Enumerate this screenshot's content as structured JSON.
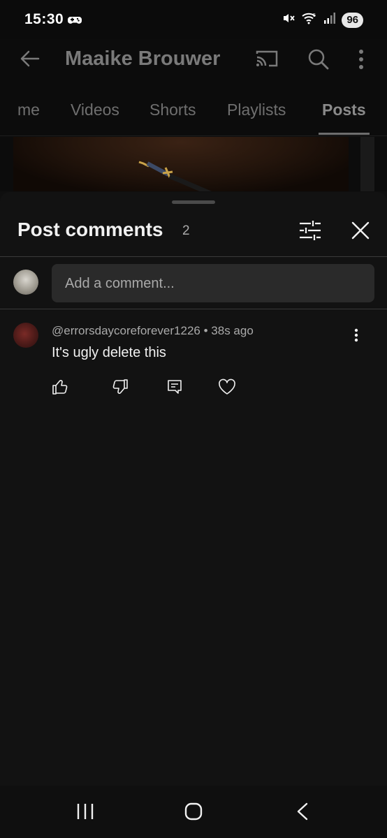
{
  "status_bar": {
    "time": "15:30",
    "battery": "96",
    "icons": [
      "game-controller-icon",
      "mute-icon",
      "wifi-icon",
      "signal-icon"
    ]
  },
  "channel": {
    "name": "Maaike Brouwer",
    "tabs": [
      {
        "label": "me",
        "active": false
      },
      {
        "label": "Videos",
        "active": false
      },
      {
        "label": "Shorts",
        "active": false
      },
      {
        "label": "Playlists",
        "active": false
      },
      {
        "label": "Posts",
        "active": true
      }
    ]
  },
  "sheet": {
    "title": "Post comments",
    "count": "2",
    "input_placeholder": "Add a comment..."
  },
  "comments": [
    {
      "author": "@errorsdaycoreforever1226",
      "time": "38s ago",
      "separator": "•",
      "text": "It's ugly delete this",
      "actions": [
        "like-icon",
        "dislike-icon",
        "reply-icon",
        "heart-icon"
      ]
    }
  ],
  "colors": {
    "background": "#0f0f0f",
    "sheet": "#121212",
    "input": "#2a2a2a",
    "text_primary": "#f1f1f1",
    "text_secondary": "#aaaaaa"
  }
}
